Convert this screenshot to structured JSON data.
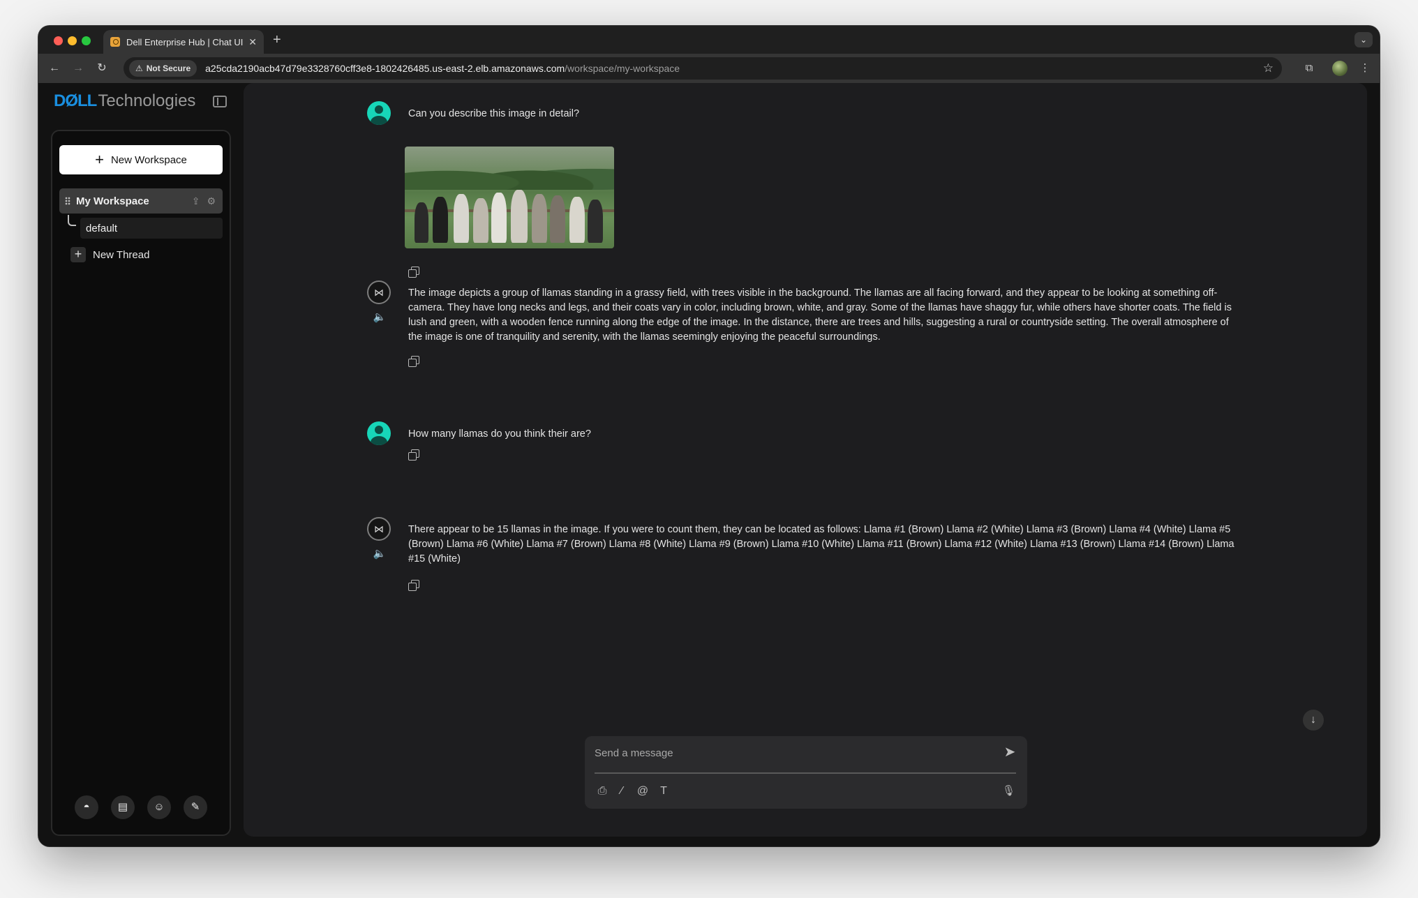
{
  "browser": {
    "tab_title": "Dell Enterprise Hub | Chat UI",
    "tab_close": "✕",
    "new_tab": "+",
    "security_label": "Not Secure",
    "url_host": "a25cda2190acb47d79e3328760cff3e8-1802426485.us-east-2.elb.amazonaws.com",
    "url_path": "/workspace/my-workspace"
  },
  "app": {
    "logo_brand": "DØLL",
    "logo_suffix": "Technologies"
  },
  "sidebar": {
    "new_workspace_label": "New Workspace",
    "workspace_label": "My Workspace",
    "thread_label": "default",
    "new_thread_label": "New Thread",
    "bottom_icons": [
      "github-icon",
      "docs-icon",
      "discord-icon",
      "settings-wrench-icon"
    ]
  },
  "chat": {
    "messages": [
      {
        "role": "user",
        "text": "Can you describe this image in detail?",
        "has_image": true
      },
      {
        "role": "assistant",
        "text": "The image depicts a group of llamas standing in a grassy field, with trees visible in the background. The llamas are all facing forward, and they appear to be looking at something off-camera. They have long necks and legs, and their coats vary in color, including brown, white, and gray. Some of the llamas have shaggy fur, while others have shorter coats. The field is lush and green, with a wooden fence running along the edge of the image. In the distance, there are trees and hills, suggesting a rural or countryside setting. The overall atmosphere of the image is one of tranquility and serenity, with the llamas seemingly enjoying the peaceful surroundings."
      },
      {
        "role": "user",
        "text": "How many llamas do you think their are?"
      },
      {
        "role": "assistant",
        "text": "There appear to be 15 llamas in the image. If you were to count them, they can be located as follows: Llama #1 (Brown) Llama #2 (White) Llama #3 (Brown) Llama #4 (White) Llama #5 (Brown) Llama #6 (White) Llama #7 (Brown) Llama #8 (White) Llama #9 (Brown) Llama #10 (White) Llama #11 (Brown) Llama #12 (White) Llama #13 (Brown) Llama #14 (Brown) Llama #15 (White)"
      }
    ]
  },
  "composer": {
    "placeholder": "Send a message"
  },
  "colors": {
    "accent_teal": "#17d6b8",
    "dell_blue": "#1a8fe0"
  }
}
